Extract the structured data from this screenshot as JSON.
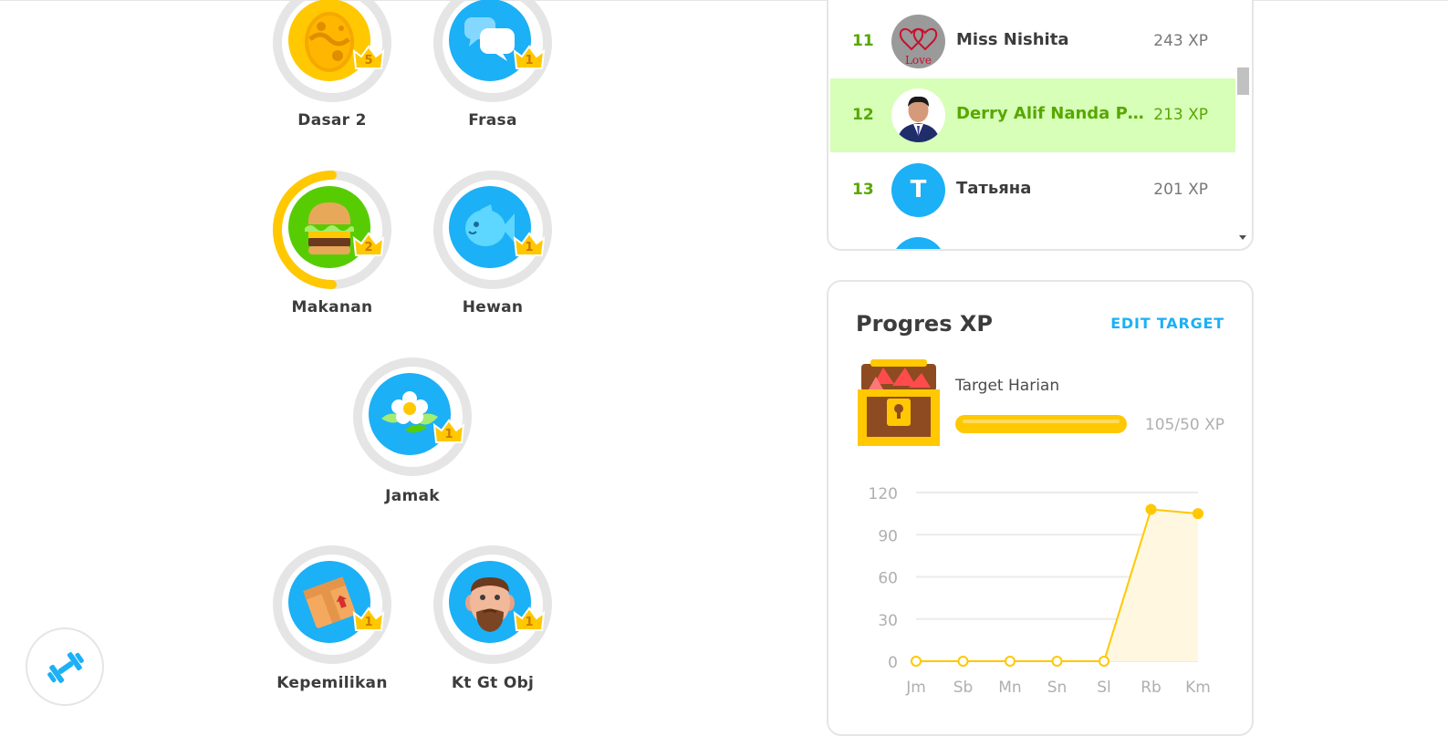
{
  "skills": [
    {
      "id": "dasar-2",
      "label": "Dasar 2",
      "level": "5",
      "icon": "egg-icon"
    },
    {
      "id": "frasa",
      "label": "Frasa",
      "level": "1",
      "icon": "chat-bubbles-icon"
    },
    {
      "id": "makanan",
      "label": "Makanan",
      "level": "2",
      "icon": "burger-icon"
    },
    {
      "id": "hewan",
      "label": "Hewan",
      "level": "1",
      "icon": "fish-icon"
    },
    {
      "id": "jamak",
      "label": "Jamak",
      "level": "1",
      "icon": "flower-icon"
    },
    {
      "id": "kepemilikan",
      "label": "Kepemilikan",
      "level": "1",
      "icon": "box-icon"
    },
    {
      "id": "kt-gt-obj",
      "label": "Kt Gt Obj",
      "level": "1",
      "icon": "man-face-icon"
    }
  ],
  "practice": {
    "icon": "dumbbell-icon"
  },
  "leaderboard": {
    "rows": [
      {
        "rank": "11",
        "name": "Miss Nishita",
        "xp": "243 XP",
        "avatar": "love-hearts-avatar"
      },
      {
        "rank": "12",
        "name": "Derry Alif Nanda Pr...",
        "xp": "213 XP",
        "avatar": "man-photo-avatar",
        "current_user": true
      },
      {
        "rank": "13",
        "name": "Татьяна",
        "xp": "201 XP",
        "avatar_letter": "T"
      }
    ]
  },
  "xp_progress": {
    "title": "Progres XP",
    "edit_label": "EDIT TARGET",
    "goal_label": "Target Harian",
    "goal_text": "105/50 XP",
    "goal_fraction": 1.0,
    "icon": "treasure-chest-icon"
  },
  "colors": {
    "accent_blue": "#1cb0f6",
    "gold": "#ffc800",
    "green": "#58a700",
    "highlight": "#d7ffb8",
    "ring_gray": "#e5e5e5"
  },
  "chart_data": {
    "type": "line",
    "categories": [
      "Jm",
      "Sb",
      "Mn",
      "Sn",
      "Sl",
      "Rb",
      "Km"
    ],
    "values": [
      0,
      0,
      0,
      0,
      0,
      108,
      105
    ],
    "yticks": [
      0,
      30,
      60,
      90,
      120
    ],
    "ylim": [
      0,
      120
    ],
    "grid": true,
    "fill": "area"
  }
}
